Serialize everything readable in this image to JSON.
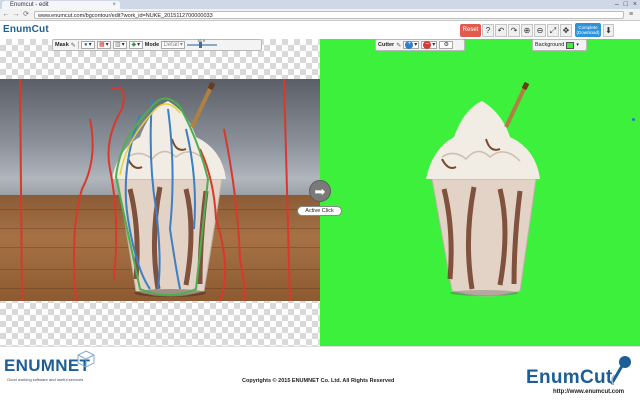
{
  "browser": {
    "tab_title": "Enumcut - edit",
    "tab_close": "×",
    "window_controls": [
      "–",
      "□",
      "×"
    ],
    "nav": {
      "back": "←",
      "forward": "→",
      "reload": "⟳"
    },
    "url": "www.enumcut.com/bgcontour/edit?work_id=NUKE_2015112700000033",
    "menu": "≡"
  },
  "header": {
    "logo_primary": "Enum",
    "logo_secondary": "Cut",
    "reset_label": "Reset",
    "tools": [
      "?",
      "↶",
      "↷",
      "⊕",
      "⊖",
      "⤢",
      "✥"
    ],
    "complete_line1": "Complete",
    "complete_line2": "(Download)",
    "download_icon": "⬇"
  },
  "mask_toolbar": {
    "label": "Mask",
    "buttons": [
      "▾",
      "▾",
      "▾",
      "▾"
    ],
    "mode_label": "Mode",
    "mode_value": "Detail",
    "slider_value": "16.9"
  },
  "cutter_toolbar": {
    "label": "Cutter",
    "add_label": "+",
    "remove_label": "–"
  },
  "background_toolbar": {
    "label": "Background",
    "color": "#3cf03c"
  },
  "center": {
    "arrow": "➡",
    "active_click_label": "Active Click"
  },
  "colors": {
    "accent": "#1d5e96",
    "reset": "#e25a4c",
    "complete": "#2e93d8",
    "green_screen": "#3cf03c",
    "mask_red": "#d8392b",
    "mask_blue": "#3b7fc4",
    "mask_green": "#4caf50",
    "mask_yellow": "#e3d23a"
  },
  "footer": {
    "company_logo": "ENUMNET",
    "company_tagline": "Good working software and useful services",
    "copyright": "Copyrights © 2015 ENUMNET Co. Ltd. All Rights Reserved",
    "product_logo": "EnumCut",
    "website": "http://www.enumcut.com"
  }
}
